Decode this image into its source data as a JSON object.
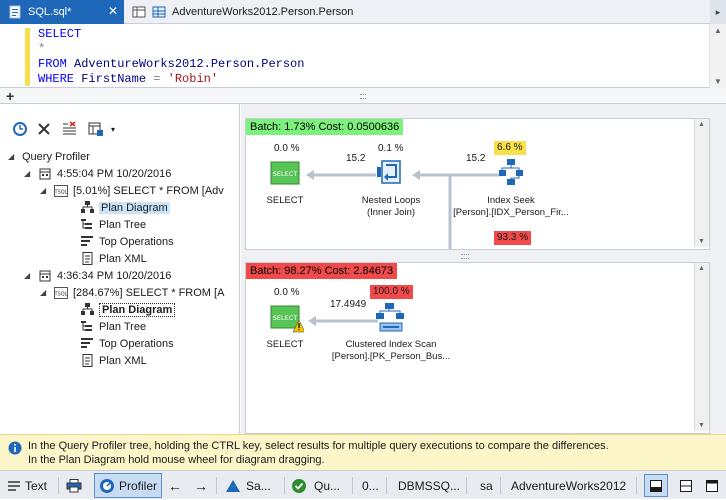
{
  "tabs": [
    {
      "label": "SQL.sql*"
    },
    {
      "label": "AdventureWorks2012.Person.Person"
    }
  ],
  "editor": {
    "lines": [
      {
        "kw": "SELECT"
      },
      {
        "text": "*"
      },
      {
        "kw": "FROM",
        "id": "AdventureWorks2012.Person.Person"
      },
      {
        "kw": "WHERE",
        "id": "FirstName",
        "op": "=",
        "str": "'Robin'"
      }
    ]
  },
  "tree": {
    "root": "Query Profiler",
    "sessions": [
      {
        "time": "4:55:04 PM 10/20/2016",
        "query": "[5.01%] SELECT * FROM [Adv",
        "items": [
          "Plan Diagram",
          "Plan Tree",
          "Top Operations",
          "Plan XML"
        ]
      },
      {
        "time": "4:36:34 PM 10/20/2016",
        "query": "[284.67%] SELECT * FROM [A",
        "items": [
          "Plan Diagram",
          "Plan Tree",
          "Top Operations",
          "Plan XML"
        ]
      }
    ]
  },
  "diagram1": {
    "batch": "Batch: 1.73% Cost: 0.0500636",
    "batch_color": "#7cf27c",
    "select": {
      "pct": "0.0 %",
      "label": "SELECT"
    },
    "arrow1": "15.2",
    "loops": {
      "pct": "0.1 %",
      "label1": "Nested Loops",
      "label2": "(Inner Join)"
    },
    "arrow2": "15.2",
    "seek": {
      "pct": "6.6 %",
      "pct_color": "#f7e04a",
      "label1": "Index Seek",
      "label2": "[Person].[IDX_Person_Fir..."
    },
    "lower_pct": "93.3 %",
    "lower_pct_color": "#f04a4a"
  },
  "diagram2": {
    "batch": "Batch: 98.27% Cost: 2.84673",
    "batch_color": "#f04a4a",
    "select": {
      "pct": "0.0 %",
      "label": "SELECT"
    },
    "arrow1": "17.4949",
    "scan": {
      "pct": "100.0 %",
      "pct_color": "#f04a4a",
      "label1": "Clustered Index Scan",
      "label2": "[Person].[PK_Person_Bus..."
    }
  },
  "icons": {
    "select_icon_text": "SELECT"
  },
  "info": {
    "line1": "In the Query Profiler tree, holding the CTRL key, select results for multiple query executions to compare the differences.",
    "line2": "In the Plan Diagram hold mouse wheel for diagram dragging."
  },
  "statusbar": {
    "text": "Text",
    "profiler": "Profiler",
    "sa_short": "Sa...",
    "qu_short": "Qu...",
    "zero_short": "0...",
    "server": "DBMSSQ...",
    "user": "sa",
    "database": "AdventureWorks2012"
  }
}
